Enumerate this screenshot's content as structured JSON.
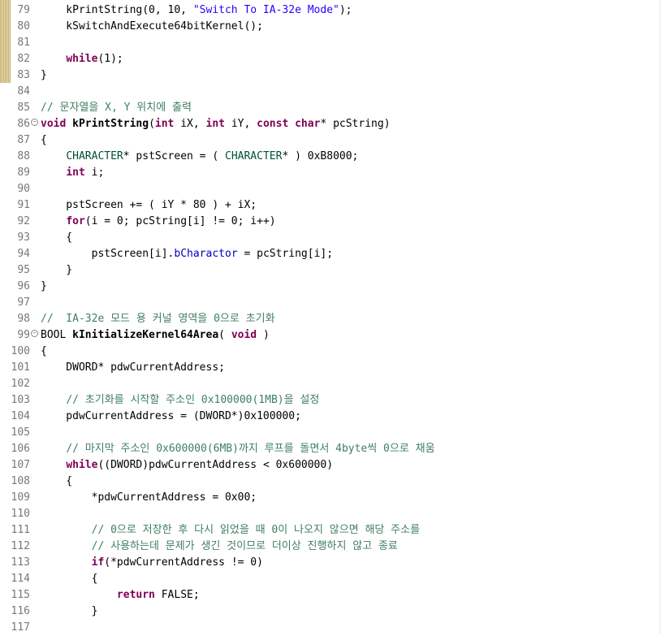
{
  "editor": {
    "lines": [
      {
        "n": "79",
        "segments": [
          {
            "t": "    kPrintString(0, 10, ",
            "c": ""
          },
          {
            "t": "\"Switch To IA-32e Mode\"",
            "c": "str"
          },
          {
            "t": ");",
            "c": ""
          }
        ]
      },
      {
        "n": "80",
        "segments": [
          {
            "t": "    kSwitchAndExecute64bitKernel();",
            "c": ""
          }
        ]
      },
      {
        "n": "81",
        "segments": []
      },
      {
        "n": "82",
        "segments": [
          {
            "t": "    ",
            "c": ""
          },
          {
            "t": "while",
            "c": "kw"
          },
          {
            "t": "(1);",
            "c": ""
          }
        ]
      },
      {
        "n": "83",
        "segments": [
          {
            "t": "}",
            "c": ""
          }
        ]
      },
      {
        "n": "84",
        "segments": []
      },
      {
        "n": "85",
        "segments": [
          {
            "t": "// 문자열을 X, Y 위치에 출력",
            "c": "cm"
          }
        ]
      },
      {
        "n": "86",
        "fold": true,
        "segments": [
          {
            "t": "void",
            "c": "kw"
          },
          {
            "t": " ",
            "c": ""
          },
          {
            "t": "kPrintString",
            "c": "fn"
          },
          {
            "t": "(",
            "c": ""
          },
          {
            "t": "int",
            "c": "kw"
          },
          {
            "t": " iX, ",
            "c": ""
          },
          {
            "t": "int",
            "c": "kw"
          },
          {
            "t": " iY, ",
            "c": ""
          },
          {
            "t": "const",
            "c": "kw"
          },
          {
            "t": " ",
            "c": ""
          },
          {
            "t": "char",
            "c": "kw"
          },
          {
            "t": "* pcString)",
            "c": ""
          }
        ]
      },
      {
        "n": "87",
        "segments": [
          {
            "t": "{",
            "c": ""
          }
        ]
      },
      {
        "n": "88",
        "segments": [
          {
            "t": "    ",
            "c": ""
          },
          {
            "t": "CHARACTER",
            "c": "ty"
          },
          {
            "t": "* pstScreen = ( ",
            "c": ""
          },
          {
            "t": "CHARACTER",
            "c": "ty"
          },
          {
            "t": "* ) 0xB8000;",
            "c": ""
          }
        ]
      },
      {
        "n": "89",
        "segments": [
          {
            "t": "    ",
            "c": ""
          },
          {
            "t": "int",
            "c": "kw"
          },
          {
            "t": " i;",
            "c": ""
          }
        ]
      },
      {
        "n": "90",
        "segments": []
      },
      {
        "n": "91",
        "segments": [
          {
            "t": "    pstScreen += ( iY * 80 ) + iX;",
            "c": ""
          }
        ]
      },
      {
        "n": "92",
        "segments": [
          {
            "t": "    ",
            "c": ""
          },
          {
            "t": "for",
            "c": "kw"
          },
          {
            "t": "(i = 0; pcString[i] != 0; i++)",
            "c": ""
          }
        ]
      },
      {
        "n": "93",
        "segments": [
          {
            "t": "    {",
            "c": ""
          }
        ]
      },
      {
        "n": "94",
        "segments": [
          {
            "t": "        pstScreen[i].",
            "c": ""
          },
          {
            "t": "bCharactor",
            "c": "fld"
          },
          {
            "t": " = pcString[i];",
            "c": ""
          }
        ]
      },
      {
        "n": "95",
        "segments": [
          {
            "t": "    }",
            "c": ""
          }
        ]
      },
      {
        "n": "96",
        "segments": [
          {
            "t": "}",
            "c": ""
          }
        ]
      },
      {
        "n": "97",
        "segments": []
      },
      {
        "n": "98",
        "segments": [
          {
            "t": "//  IA-32e 모드 용 커널 영역을 0으로 초기화",
            "c": "cm"
          }
        ]
      },
      {
        "n": "99",
        "fold": true,
        "segments": [
          {
            "t": "BOOL ",
            "c": ""
          },
          {
            "t": "kInitializeKernel64Area",
            "c": "fn"
          },
          {
            "t": "( ",
            "c": ""
          },
          {
            "t": "void",
            "c": "kw"
          },
          {
            "t": " )",
            "c": ""
          }
        ]
      },
      {
        "n": "100",
        "segments": [
          {
            "t": "{",
            "c": ""
          }
        ]
      },
      {
        "n": "101",
        "segments": [
          {
            "t": "    DWORD* pdwCurrentAddress;",
            "c": ""
          }
        ]
      },
      {
        "n": "102",
        "segments": []
      },
      {
        "n": "103",
        "segments": [
          {
            "t": "    ",
            "c": ""
          },
          {
            "t": "// 초기화를 시작할 주소인 0x100000(1MB)을 설정",
            "c": "cm"
          }
        ]
      },
      {
        "n": "104",
        "segments": [
          {
            "t": "    pdwCurrentAddress = (DWORD*)0x100000;",
            "c": ""
          }
        ]
      },
      {
        "n": "105",
        "segments": []
      },
      {
        "n": "106",
        "segments": [
          {
            "t": "    ",
            "c": ""
          },
          {
            "t": "// 마지막 주소인 0x600000(6MB)까지 루프를 돌면서 4byte씩 0으로 채움",
            "c": "cm"
          }
        ]
      },
      {
        "n": "107",
        "segments": [
          {
            "t": "    ",
            "c": ""
          },
          {
            "t": "while",
            "c": "kw"
          },
          {
            "t": "((DWORD)pdwCurrentAddress < 0x600000)",
            "c": ""
          }
        ]
      },
      {
        "n": "108",
        "segments": [
          {
            "t": "    {",
            "c": ""
          }
        ]
      },
      {
        "n": "109",
        "segments": [
          {
            "t": "        *pdwCurrentAddress = 0x00;",
            "c": ""
          }
        ]
      },
      {
        "n": "110",
        "segments": []
      },
      {
        "n": "111",
        "segments": [
          {
            "t": "        ",
            "c": ""
          },
          {
            "t": "// 0으로 저장한 후 다시 읽었을 때 0이 나오지 않으면 해당 주소를",
            "c": "cm"
          }
        ]
      },
      {
        "n": "112",
        "segments": [
          {
            "t": "        ",
            "c": ""
          },
          {
            "t": "// 사용하는데 문제가 생긴 것이므로 더이상 진행하지 않고 종료",
            "c": "cm"
          }
        ]
      },
      {
        "n": "113",
        "segments": [
          {
            "t": "        ",
            "c": ""
          },
          {
            "t": "if",
            "c": "kw"
          },
          {
            "t": "(*pdwCurrentAddress != 0)",
            "c": ""
          }
        ]
      },
      {
        "n": "114",
        "segments": [
          {
            "t": "        {",
            "c": ""
          }
        ]
      },
      {
        "n": "115",
        "segments": [
          {
            "t": "            ",
            "c": ""
          },
          {
            "t": "return",
            "c": "kw"
          },
          {
            "t": " FALSE;",
            "c": ""
          }
        ]
      },
      {
        "n": "116",
        "segments": [
          {
            "t": "        }",
            "c": ""
          }
        ]
      },
      {
        "n": "117",
        "segments": []
      }
    ]
  }
}
